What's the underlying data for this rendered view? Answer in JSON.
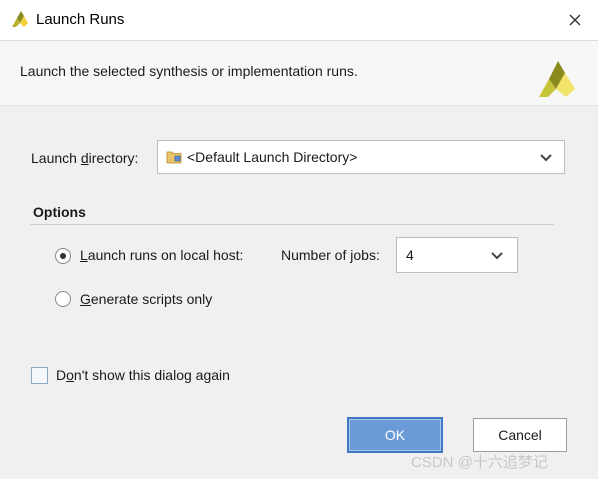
{
  "window": {
    "title": "Launch Runs",
    "icon": "vivado-logo-icon",
    "close_icon": "close-icon"
  },
  "header": {
    "description": "Launch the selected synthesis or implementation runs.",
    "logo": "vivado-logo-icon"
  },
  "launch_directory": {
    "label_pre": "Launch ",
    "label_mnemonic": "d",
    "label_post": "irectory:",
    "value": "<Default Launch Directory>",
    "folder_icon": "folder-icon"
  },
  "options": {
    "title": "Options",
    "local_host": {
      "mnemonic": "L",
      "rest": "aunch runs on local host:",
      "selected": true
    },
    "number_of_jobs": {
      "label_pre": "Number of ",
      "label_mnemonic": "j",
      "label_post": "obs:",
      "value": "4"
    },
    "generate_scripts": {
      "mnemonic": "G",
      "rest": "enerate scripts only",
      "selected": false
    }
  },
  "dont_show": {
    "pre": "D",
    "mnemonic": "o",
    "rest": "n't show this dialog again",
    "checked": false
  },
  "buttons": {
    "ok": "OK",
    "cancel": "Cancel"
  },
  "watermark": "CSDN @十六追梦记",
  "colors": {
    "accent": "#6a9bd8",
    "logo_yellow": "#f2d13a",
    "logo_olive": "#8a8a1e"
  }
}
